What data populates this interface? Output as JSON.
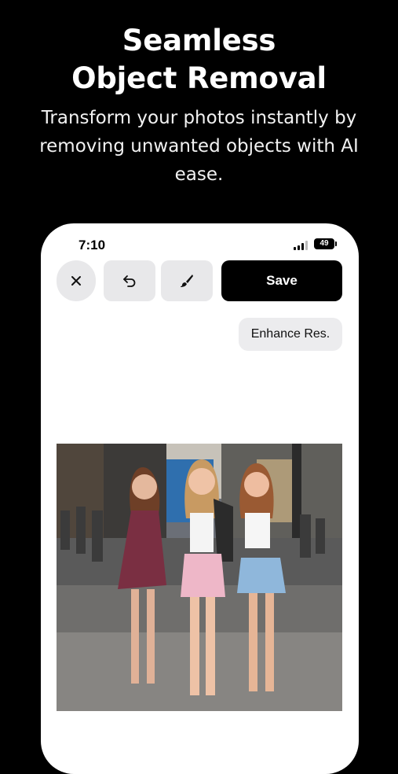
{
  "hero": {
    "title_line1": "Seamless",
    "title_line2": "Object Removal",
    "subtitle": "Transform your photos instantly by removing unwanted objects with AI ease."
  },
  "status_bar": {
    "time": "7:10",
    "battery": "49",
    "icons": [
      "signal-icon",
      "battery-icon"
    ]
  },
  "toolbar": {
    "close_icon": "close-icon",
    "undo_icon": "undo-icon",
    "brush_icon": "brush-icon",
    "save_label": "Save"
  },
  "enhance_label": "Enhance Res.",
  "colors": {
    "background": "#000000",
    "card": "#ffffff",
    "button_gray": "#e8e8ea",
    "save_button": "#000000"
  }
}
